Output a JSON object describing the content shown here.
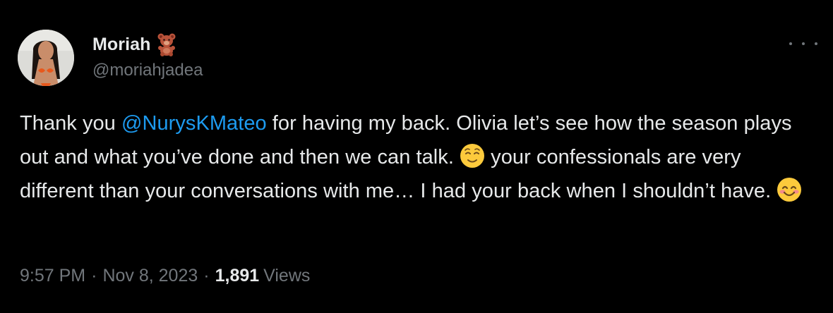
{
  "author": {
    "display_name": "Moriah",
    "name_emoji": "teddy-bear-emoji",
    "handle": "@moriahjadea"
  },
  "tweet": {
    "text_1": "Thank you ",
    "mention": "@NurysKMateo",
    "text_2": " for having my back. Olivia let’s see how the season plays out and what you’ve done and then we can talk. ",
    "emoji_1": "relieved-face-emoji",
    "text_3": " your confessionals are very different than your conversations with me… I had your back when I shouldn’t have. ",
    "emoji_2": "smiling-face-with-smiling-eyes-emoji"
  },
  "meta": {
    "time": "9:57 PM",
    "separator": "·",
    "date": "Nov 8, 2023",
    "views_count": "1,891",
    "views_label": "Views"
  },
  "colors": {
    "background": "#000000",
    "text": "#e7e9ea",
    "secondary": "#71767b",
    "accent": "#1d9bf0"
  },
  "icons": {
    "more": "more-horizontal-icon"
  }
}
